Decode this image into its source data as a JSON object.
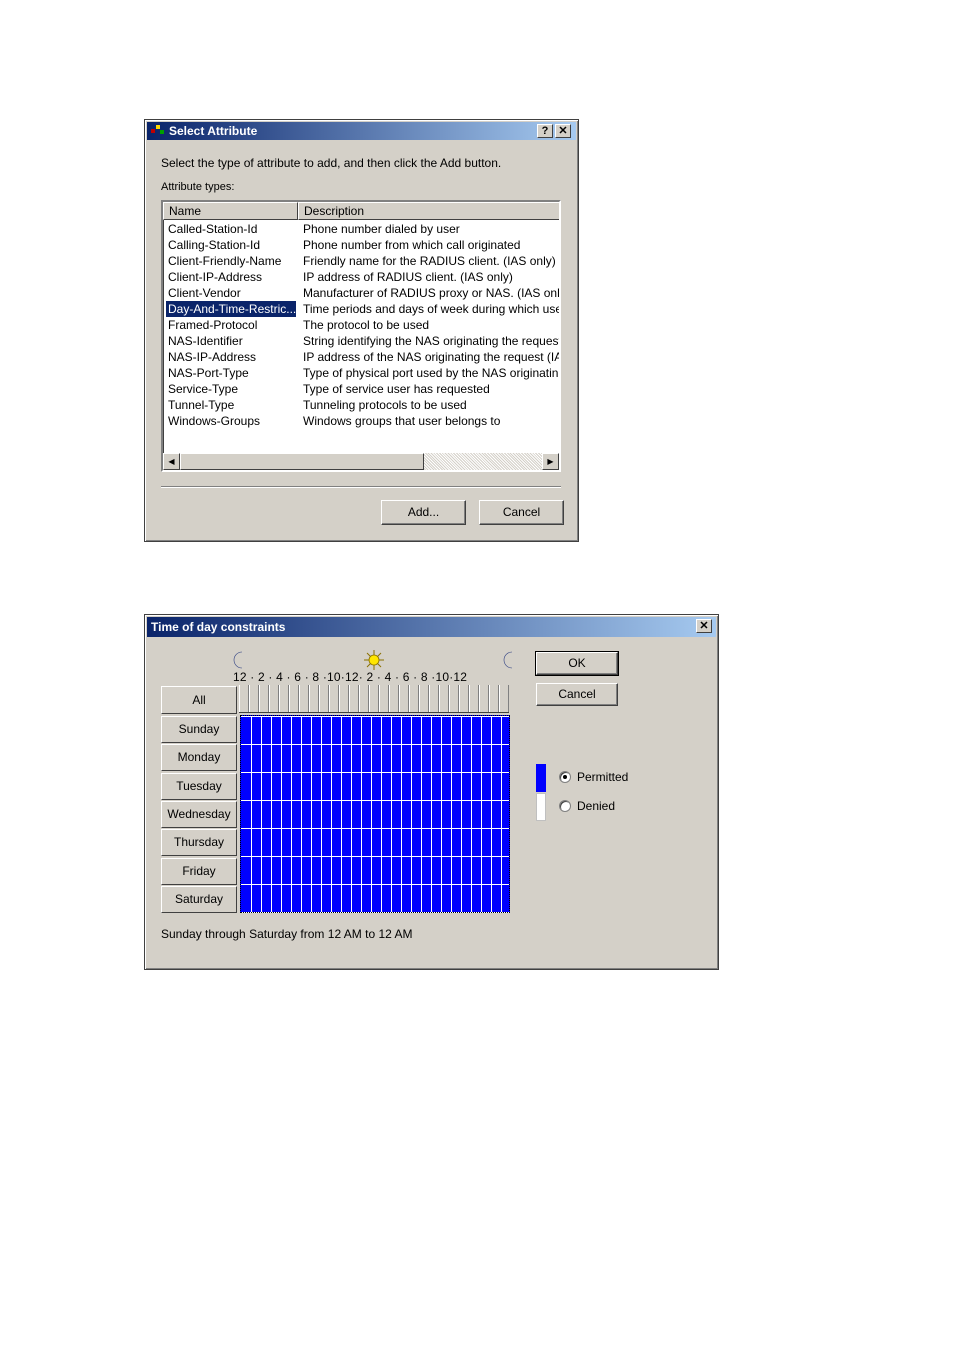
{
  "select_attribute": {
    "title": "Select Attribute",
    "help_btn": "?",
    "close_btn": "✕",
    "instruction": "Select the type of attribute to add, and then click the Add button.",
    "list_label": "Attribute types:",
    "columns": [
      "Name",
      "Description"
    ],
    "rows": [
      {
        "name": "Called-Station-Id",
        "desc": "Phone number dialed by user"
      },
      {
        "name": "Calling-Station-Id",
        "desc": "Phone number from which call originated"
      },
      {
        "name": "Client-Friendly-Name",
        "desc": "Friendly name for the RADIUS client. (IAS only)"
      },
      {
        "name": "Client-IP-Address",
        "desc": "IP address of RADIUS client. (IAS only)"
      },
      {
        "name": "Client-Vendor",
        "desc": "Manufacturer of RADIUS proxy or NAS. (IAS onl"
      },
      {
        "name": "Day-And-Time-Restric...",
        "desc": "Time periods and days of week during which use"
      },
      {
        "name": "Framed-Protocol",
        "desc": "The protocol to be used"
      },
      {
        "name": "NAS-Identifier",
        "desc": "String identifying the NAS originating the request"
      },
      {
        "name": "NAS-IP-Address",
        "desc": "IP address of the NAS originating the request (IA"
      },
      {
        "name": "NAS-Port-Type",
        "desc": "Type of physical port used by the NAS originatin"
      },
      {
        "name": "Service-Type",
        "desc": "Type of service user has requested"
      },
      {
        "name": "Tunnel-Type",
        "desc": "Tunneling protocols to be used"
      },
      {
        "name": "Windows-Groups",
        "desc": "Windows groups that user belongs to"
      }
    ],
    "selected_index": 5,
    "add_button": "Add...",
    "cancel_button": "Cancel"
  },
  "time_constraints": {
    "title": "Time of day constraints",
    "close_btn": "✕",
    "hour_labels": "12 · 2 · 4 · 6 · 8 ·10·12· 2 · 4 · 6 · 8 ·10·12",
    "all_label": "All",
    "days": [
      "Sunday",
      "Monday",
      "Tuesday",
      "Wednesday",
      "Thursday",
      "Friday",
      "Saturday"
    ],
    "ok_button": "OK",
    "cancel_button": "Cancel",
    "legend": [
      {
        "label": "Permitted",
        "color": "#0000ff",
        "checked": true
      },
      {
        "label": "Denied",
        "color": "#ffffff",
        "checked": false
      }
    ],
    "summary": "Sunday through Saturday from 12 AM to 12 AM"
  }
}
